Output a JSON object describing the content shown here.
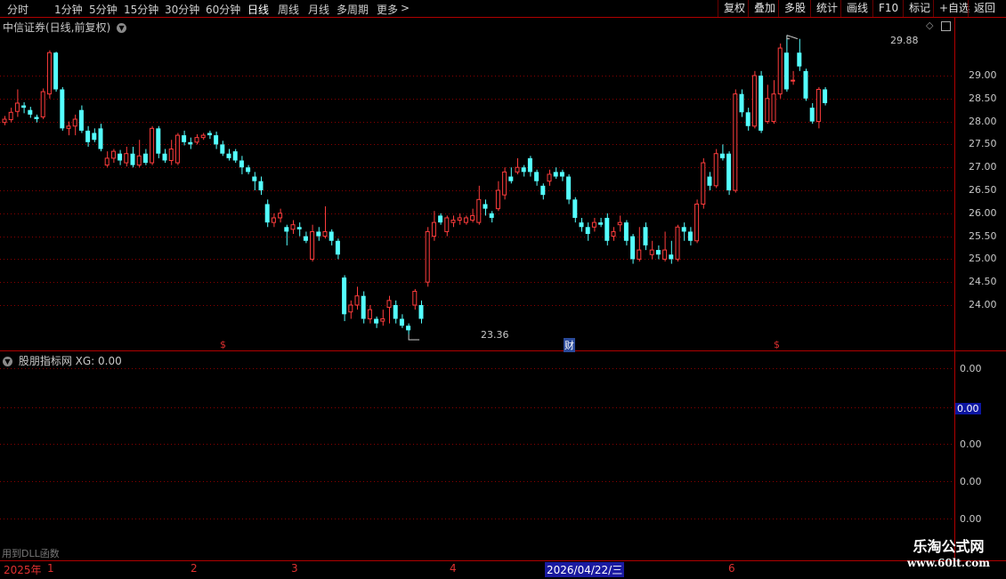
{
  "toolbar": {
    "periods": [
      "分时",
      "1分钟",
      "5分钟",
      "15分钟",
      "30分钟",
      "60分钟",
      "日线",
      "周线",
      "月线",
      "多周期",
      "更多"
    ],
    "active_period": "日线",
    "more_arrow": ">",
    "right_buttons": [
      "复权",
      "叠加",
      "多股",
      "统计",
      "画线",
      "F10",
      "标记",
      "+自选",
      "返回"
    ]
  },
  "main_panel": {
    "title": "中信证券(日线,前复权)",
    "high_label": "29.88",
    "low_label": "23.36",
    "markers": [
      "$",
      "财",
      "$"
    ]
  },
  "indicator_panel": {
    "title": "股朋指标网 XG: 0.00",
    "y_labels": [
      "0.00",
      "0.00",
      "0.00",
      "0.00",
      "0.00"
    ],
    "selected_label": "0.00"
  },
  "status": {
    "dll_text": "用到DLL函数"
  },
  "bottombar": {
    "year": "2025年",
    "months": [
      "1",
      "2",
      "3",
      "4",
      "6"
    ],
    "date": "2026/04/22/三"
  },
  "watermark": {
    "line1": "乐淘公式网",
    "line2": "www.60lt.com"
  },
  "colors": {
    "up": "#ff3c3c",
    "down": "#54ffff",
    "grid": "#8a0000",
    "axis": "#b00000"
  },
  "chart_data": {
    "type": "candlestick",
    "title": "中信证券(日线,前复权)",
    "ylim": [
      23.0,
      30.4
    ],
    "y_ticks": [
      24.0,
      24.5,
      25.0,
      25.5,
      26.0,
      26.5,
      27.0,
      27.5,
      28.0,
      28.5,
      29.0
    ],
    "grid": true,
    "max_point": 29.88,
    "min_point": 23.36,
    "candles": [
      [
        27.98,
        28.05,
        28.12,
        27.92
      ],
      [
        28.04,
        28.2,
        28.3,
        27.98
      ],
      [
        28.22,
        28.4,
        28.7,
        28.1
      ],
      [
        28.35,
        28.3,
        28.42,
        28.18
      ],
      [
        28.25,
        28.15,
        28.32,
        28.08
      ],
      [
        28.1,
        28.05,
        28.15,
        27.98
      ],
      [
        28.1,
        28.65,
        28.72,
        28.05
      ],
      [
        28.6,
        29.5,
        29.55,
        28.5
      ],
      [
        29.5,
        28.7,
        29.52,
        28.65
      ],
      [
        28.7,
        27.85,
        28.75,
        27.8
      ],
      [
        27.85,
        27.9,
        28.0,
        27.7
      ],
      [
        27.9,
        28.05,
        28.15,
        27.7
      ],
      [
        28.25,
        27.8,
        28.35,
        27.75
      ],
      [
        27.8,
        27.55,
        27.9,
        27.45
      ],
      [
        27.75,
        27.6,
        27.85,
        27.55
      ],
      [
        27.85,
        27.4,
        27.95,
        27.35
      ],
      [
        27.05,
        27.2,
        27.35,
        27.0
      ],
      [
        27.2,
        27.35,
        27.4,
        27.1
      ],
      [
        27.3,
        27.15,
        27.38,
        27.05
      ],
      [
        27.1,
        27.3,
        27.45,
        27.02
      ],
      [
        27.3,
        27.05,
        27.45,
        27.0
      ],
      [
        27.05,
        27.25,
        27.6,
        27.0
      ],
      [
        27.3,
        27.1,
        27.4,
        27.05
      ],
      [
        27.1,
        27.85,
        27.9,
        27.05
      ],
      [
        27.85,
        27.3,
        27.9,
        27.2
      ],
      [
        27.3,
        27.15,
        27.4,
        27.1
      ],
      [
        27.15,
        27.4,
        27.6,
        27.05
      ],
      [
        27.1,
        27.7,
        27.75,
        27.05
      ],
      [
        27.7,
        27.55,
        27.8,
        27.48
      ],
      [
        27.55,
        27.5,
        27.65,
        27.4
      ],
      [
        27.55,
        27.65,
        27.72,
        27.5
      ],
      [
        27.65,
        27.7,
        27.75,
        27.6
      ],
      [
        27.75,
        27.7,
        27.8,
        27.62
      ],
      [
        27.7,
        27.5,
        27.78,
        27.4
      ],
      [
        27.5,
        27.3,
        27.58,
        27.25
      ],
      [
        27.3,
        27.2,
        27.4,
        27.15
      ],
      [
        27.35,
        27.15,
        27.4,
        27.1
      ],
      [
        27.15,
        27.0,
        27.25,
        26.85
      ],
      [
        27.0,
        26.9,
        27.05,
        26.85
      ],
      [
        26.8,
        26.7,
        26.9,
        26.5
      ],
      [
        26.7,
        26.5,
        26.8,
        26.4
      ],
      [
        26.2,
        25.8,
        26.3,
        25.7
      ],
      [
        25.8,
        25.9,
        26.0,
        25.7
      ],
      [
        25.9,
        26.0,
        26.1,
        25.8
      ],
      [
        25.7,
        25.6,
        25.75,
        25.3
      ],
      [
        25.65,
        25.75,
        25.85,
        25.55
      ],
      [
        25.7,
        25.65,
        25.8,
        25.5
      ],
      [
        25.5,
        25.4,
        25.6,
        25.35
      ],
      [
        25.0,
        25.6,
        25.75,
        24.95
      ],
      [
        25.6,
        25.5,
        25.7,
        25.4
      ],
      [
        25.5,
        25.6,
        26.15,
        25.45
      ],
      [
        25.6,
        25.4,
        25.65,
        25.3
      ],
      [
        25.4,
        25.1,
        25.45,
        25.0
      ],
      [
        24.6,
        23.8,
        24.65,
        23.65
      ],
      [
        23.85,
        24.0,
        24.1,
        23.7
      ],
      [
        24.0,
        24.2,
        24.4,
        23.9
      ],
      [
        24.2,
        23.7,
        24.3,
        23.6
      ],
      [
        23.7,
        23.9,
        24.0,
        23.6
      ],
      [
        23.7,
        23.6,
        23.75,
        23.5
      ],
      [
        23.65,
        23.7,
        23.9,
        23.55
      ],
      [
        23.95,
        24.1,
        24.2,
        23.6
      ],
      [
        24.0,
        23.7,
        24.1,
        23.6
      ],
      [
        23.7,
        23.55,
        23.8,
        23.5
      ],
      [
        23.55,
        23.45,
        23.6,
        23.36
      ],
      [
        24.0,
        24.3,
        24.35,
        23.9
      ],
      [
        24.0,
        23.7,
        24.1,
        23.6
      ],
      [
        24.5,
        25.6,
        25.7,
        24.4
      ],
      [
        25.5,
        25.8,
        26.05,
        25.4
      ],
      [
        25.95,
        25.8,
        26.0,
        25.75
      ],
      [
        25.6,
        25.9,
        25.95,
        25.5
      ],
      [
        25.8,
        25.85,
        25.95,
        25.7
      ],
      [
        25.85,
        25.9,
        26.0,
        25.75
      ],
      [
        25.8,
        25.9,
        25.95,
        25.75
      ],
      [
        25.85,
        25.95,
        26.1,
        25.8
      ],
      [
        25.8,
        26.3,
        26.6,
        25.75
      ],
      [
        26.2,
        26.1,
        26.3,
        25.95
      ],
      [
        26.0,
        25.9,
        26.05,
        25.8
      ],
      [
        26.1,
        26.5,
        26.7,
        26.05
      ],
      [
        26.4,
        26.9,
        27.0,
        26.3
      ],
      [
        26.8,
        26.7,
        27.0,
        26.65
      ],
      [
        26.9,
        27.0,
        27.2,
        26.85
      ],
      [
        27.0,
        26.9,
        27.05,
        26.8
      ],
      [
        27.2,
        26.9,
        27.25,
        26.8
      ],
      [
        26.9,
        26.7,
        26.95,
        26.6
      ],
      [
        26.6,
        26.4,
        26.65,
        26.3
      ],
      [
        26.7,
        26.85,
        26.95,
        26.6
      ],
      [
        26.9,
        26.8,
        27.0,
        26.75
      ],
      [
        26.9,
        26.8,
        26.95,
        26.7
      ],
      [
        26.8,
        26.3,
        26.85,
        26.2
      ],
      [
        26.3,
        25.9,
        26.35,
        25.8
      ],
      [
        25.8,
        25.7,
        25.9,
        25.6
      ],
      [
        25.7,
        25.55,
        25.8,
        25.4
      ],
      [
        25.7,
        25.8,
        25.9,
        25.6
      ],
      [
        25.8,
        25.75,
        25.9,
        25.7
      ],
      [
        25.9,
        25.4,
        26.0,
        25.3
      ],
      [
        25.5,
        25.6,
        25.7,
        25.4
      ],
      [
        25.75,
        25.8,
        25.95,
        25.6
      ],
      [
        25.8,
        25.4,
        25.85,
        25.3
      ],
      [
        25.5,
        25.0,
        25.55,
        24.9
      ],
      [
        25.0,
        25.2,
        25.7,
        24.95
      ],
      [
        25.7,
        25.3,
        25.8,
        25.2
      ],
      [
        25.1,
        25.2,
        25.4,
        25.0
      ],
      [
        25.2,
        25.1,
        25.3,
        25.0
      ],
      [
        25.0,
        25.2,
        25.6,
        24.95
      ],
      [
        25.1,
        25.0,
        25.4,
        24.9
      ],
      [
        25.0,
        25.7,
        25.75,
        24.95
      ],
      [
        25.7,
        25.6,
        25.8,
        25.4
      ],
      [
        25.6,
        25.4,
        25.7,
        25.3
      ],
      [
        25.4,
        26.2,
        26.3,
        25.35
      ],
      [
        26.2,
        27.1,
        27.2,
        26.1
      ],
      [
        26.8,
        26.6,
        26.9,
        26.5
      ],
      [
        26.6,
        27.3,
        27.4,
        26.55
      ],
      [
        27.3,
        27.2,
        27.5,
        27.15
      ],
      [
        27.3,
        26.5,
        27.35,
        26.4
      ],
      [
        26.5,
        28.6,
        28.7,
        26.45
      ],
      [
        28.6,
        28.2,
        28.7,
        28.1
      ],
      [
        28.2,
        27.9,
        28.3,
        27.8
      ],
      [
        27.9,
        29.0,
        29.1,
        27.85
      ],
      [
        29.0,
        27.8,
        29.1,
        27.75
      ],
      [
        28.0,
        28.5,
        28.8,
        27.95
      ],
      [
        28.0,
        28.6,
        28.9,
        27.95
      ],
      [
        28.6,
        29.6,
        29.7,
        28.5
      ],
      [
        29.5,
        28.7,
        29.88,
        28.65
      ],
      [
        28.9,
        28.9,
        29.1,
        28.8
      ],
      [
        29.5,
        29.2,
        29.8,
        29.1
      ],
      [
        29.1,
        28.5,
        29.15,
        28.45
      ],
      [
        28.3,
        28.0,
        28.4,
        27.95
      ],
      [
        28.0,
        28.7,
        28.75,
        27.85
      ],
      [
        28.7,
        28.4,
        28.75,
        28.35
      ]
    ]
  }
}
